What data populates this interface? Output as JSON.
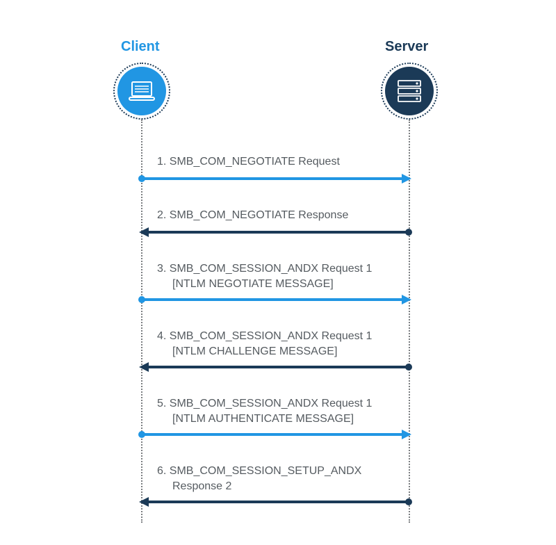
{
  "actors": {
    "client": {
      "label": "Client",
      "icon": "laptop-icon",
      "color": "#2196e3"
    },
    "server": {
      "label": "Server",
      "icon": "server-icon",
      "color": "#1b3a57"
    }
  },
  "colors": {
    "client_arrow": "#2196e3",
    "server_arrow": "#1b3a57",
    "text": "#555b60"
  },
  "messages": [
    {
      "index": 1,
      "from": "client",
      "to": "server",
      "text_line1": "1. SMB_COM_NEGOTIATE Request",
      "text_line2": ""
    },
    {
      "index": 2,
      "from": "server",
      "to": "client",
      "text_line1": "2. SMB_COM_NEGOTIATE Response",
      "text_line2": ""
    },
    {
      "index": 3,
      "from": "client",
      "to": "server",
      "text_line1": "3. SMB_COM_SESSION_ANDX Request 1",
      "text_line2": "[NTLM NEGOTIATE MESSAGE]"
    },
    {
      "index": 4,
      "from": "server",
      "to": "client",
      "text_line1": "4. SMB_COM_SESSION_ANDX Request 1",
      "text_line2": "[NTLM CHALLENGE MESSAGE]"
    },
    {
      "index": 5,
      "from": "client",
      "to": "server",
      "text_line1": "5. SMB_COM_SESSION_ANDX Request 1",
      "text_line2": "[NTLM AUTHENTICATE MESSAGE]"
    },
    {
      "index": 6,
      "from": "server",
      "to": "client",
      "text_line1": "6. SMB_COM_SESSION_SETUP_ANDX",
      "text_line2": "Response 2"
    }
  ]
}
